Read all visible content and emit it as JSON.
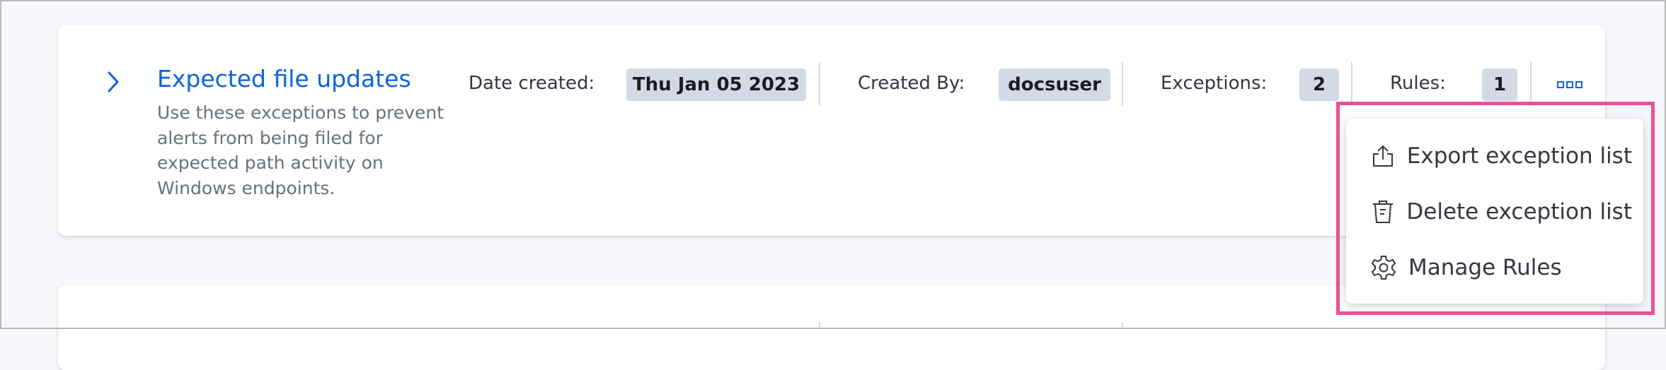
{
  "list": {
    "title": "Expected file updates",
    "description": "Use these exceptions to prevent alerts from being filed for expected path activity on Windows endpoints.",
    "date_created_label": "Date created:",
    "date_created_value": "Thu Jan 05 2023",
    "created_by_label": "Created By:",
    "created_by_value": "docsuser",
    "exceptions_label": "Exceptions:",
    "exceptions_value": "2",
    "rules_label": "Rules:",
    "rules_value": "1"
  },
  "menu": {
    "items": [
      {
        "label": "Export exception list",
        "icon": "export-icon"
      },
      {
        "label": "Delete exception list",
        "icon": "trash-icon"
      },
      {
        "label": "Manage Rules",
        "icon": "gear-icon"
      }
    ]
  },
  "colors": {
    "title": "#0b64dd",
    "badge_bg": "#d3dae6",
    "highlight": "#f04e98"
  }
}
